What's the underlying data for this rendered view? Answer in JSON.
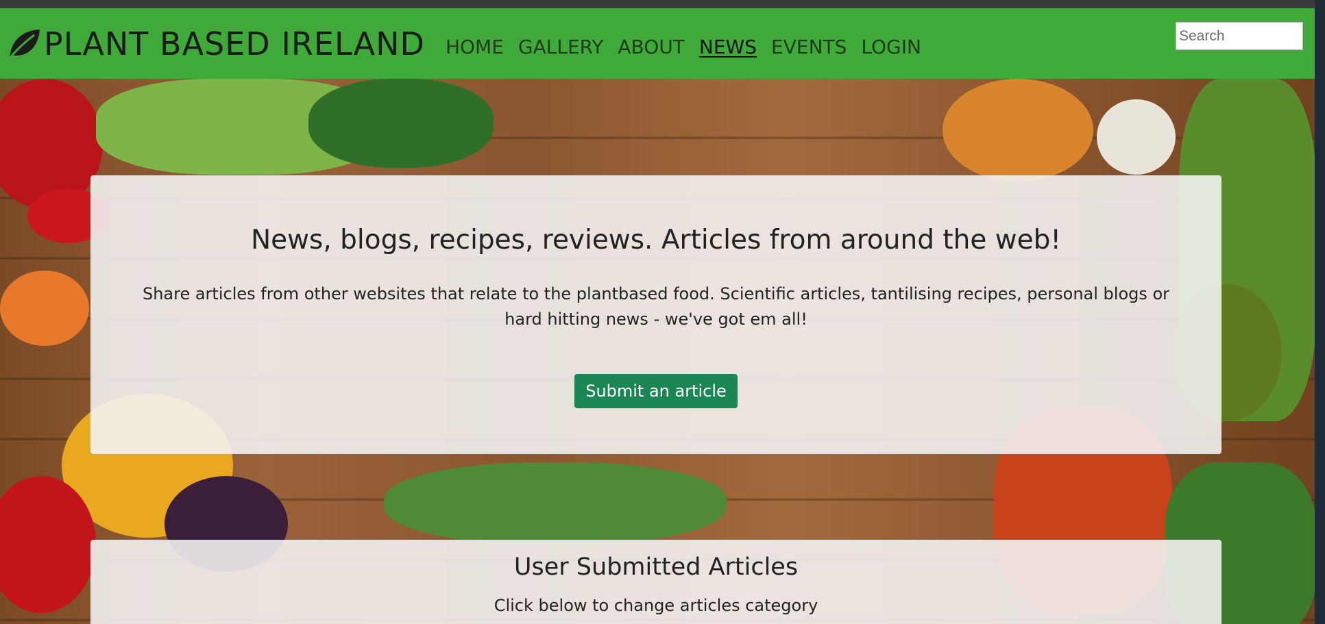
{
  "navbar": {
    "brand": "PLANT BASED IRELAND",
    "links": [
      "HOME",
      "GALLERY",
      "ABOUT",
      "NEWS",
      "EVENTS",
      "LOGIN"
    ],
    "active": "NEWS",
    "search_placeholder": "Search"
  },
  "hero_card": {
    "title": "News, blogs, recipes, reviews. Articles from around the web!",
    "description": "Share articles from other websites that relate to the plantbased food. Scientific articles, tantilising recipes, personal blogs or hard hitting news - we've got em all!",
    "button_label": "Submit an article"
  },
  "articles_card": {
    "title": "User Submitted Articles",
    "subtitle": "Click below to change articles category"
  },
  "colors": {
    "navbar": "#3faa3a",
    "button": "#1a8754"
  }
}
